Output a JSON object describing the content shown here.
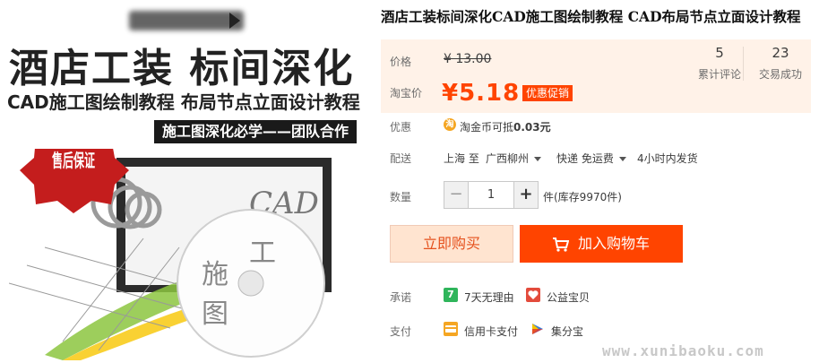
{
  "product_image": {
    "title": "酒店工装 标间深化",
    "subtitle": "CAD施工图绘制教程 布局节点立面设计教程",
    "banner": "施工图深化必学——团队合作",
    "badge": "售后保证",
    "disc_text_1": "施",
    "disc_text_2": "工",
    "disc_text_3": "图",
    "cad_text": "CAD"
  },
  "title": "酒店工装标间深化CAD施工图绘制教程 CAD布局节点立面设计教程",
  "price": {
    "label": "价格",
    "original": "¥ 13.00",
    "promo_label": "淘宝价",
    "current": "¥5.18",
    "promo_badge": "优惠促销"
  },
  "stats": [
    {
      "value": "5",
      "label": "累计评论"
    },
    {
      "value": "23",
      "label": "交易成功"
    }
  ],
  "discount": {
    "label": "优惠",
    "icon_text": "淘",
    "text": "淘金币可抵",
    "amount": "0.03元"
  },
  "shipping": {
    "label": "配送",
    "from": "上海 至",
    "to": "广西柳州",
    "method": "快递 免运费",
    "dispatch": "4小时内发货"
  },
  "quantity": {
    "label": "数量",
    "value": "1",
    "minus": "−",
    "plus": "+",
    "stock": "件(库存9970件)"
  },
  "buttons": {
    "buy_now": "立即购买",
    "add_cart": "加入购物车"
  },
  "promise": {
    "label": "承诺",
    "items": [
      {
        "icon_text": "7",
        "text": "7天无理由"
      },
      {
        "text": "公益宝贝"
      }
    ]
  },
  "payment": {
    "label": "支付",
    "items": [
      {
        "text": "信用卡支付"
      },
      {
        "text": "集分宝"
      }
    ]
  },
  "watermark": "www.xunibaoku.com",
  "colors": {
    "accent": "#ff4400",
    "price_bg": "#fff2e8",
    "buy_bg": "#ffe4d0"
  }
}
